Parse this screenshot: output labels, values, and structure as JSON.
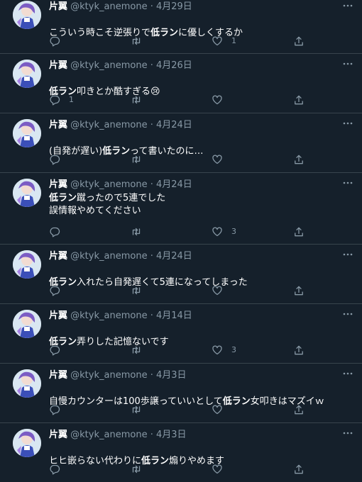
{
  "tweets": [
    {
      "display_name": "片翼",
      "handle": "@ktyk_anemone",
      "separator": "·",
      "date": "4月29日",
      "text_parts": [
        {
          "t": "こういう時こそ逆張りで",
          "b": false
        },
        {
          "t": "低ラン",
          "b": true
        },
        {
          "t": "に優しくするか",
          "b": false
        }
      ],
      "replies": "",
      "retweets": "",
      "likes": "1"
    },
    {
      "display_name": "片翼",
      "handle": "@ktyk_anemone",
      "separator": "·",
      "date": "4月26日",
      "text_parts": [
        {
          "t": "低ラン",
          "b": true
        },
        {
          "t": "叩きとか酷すぎる😢",
          "b": false
        }
      ],
      "replies": "1",
      "retweets": "",
      "likes": ""
    },
    {
      "display_name": "片翼",
      "handle": "@ktyk_anemone",
      "separator": "·",
      "date": "4月24日",
      "text_parts": [
        {
          "t": "(自発が遅い)",
          "b": false
        },
        {
          "t": "低ラン",
          "b": true
        },
        {
          "t": "って書いたのに…",
          "b": false
        }
      ],
      "replies": "",
      "retweets": "",
      "likes": ""
    },
    {
      "display_name": "片翼",
      "handle": "@ktyk_anemone",
      "separator": "·",
      "date": "4月24日",
      "text_parts": [
        {
          "t": "低ラン",
          "b": true
        },
        {
          "t": "蹴ったので5連でした\n誤情報やめてください",
          "b": false
        }
      ],
      "replies": "",
      "retweets": "",
      "likes": "3"
    },
    {
      "display_name": "片翼",
      "handle": "@ktyk_anemone",
      "separator": "·",
      "date": "4月24日",
      "text_parts": [
        {
          "t": "低ラン",
          "b": true
        },
        {
          "t": "入れたら自発遅くて5連になってしまった",
          "b": false
        }
      ],
      "replies": "",
      "retweets": "",
      "likes": ""
    },
    {
      "display_name": "片翼",
      "handle": "@ktyk_anemone",
      "separator": "·",
      "date": "4月14日",
      "text_parts": [
        {
          "t": "低ラン",
          "b": true
        },
        {
          "t": "弄りした記憶ないです",
          "b": false
        }
      ],
      "replies": "",
      "retweets": "",
      "likes": "3"
    },
    {
      "display_name": "片翼",
      "handle": "@ktyk_anemone",
      "separator": "·",
      "date": "4月3日",
      "text_parts": [
        {
          "t": "自慢カウンターは100歩譲っていいとして",
          "b": false
        },
        {
          "t": "低ラン",
          "b": true
        },
        {
          "t": "女叩きはマズイｗ",
          "b": false
        }
      ],
      "replies": "",
      "retweets": "",
      "likes": ""
    },
    {
      "display_name": "片翼",
      "handle": "@ktyk_anemone",
      "separator": "·",
      "date": "4月3日",
      "text_parts": [
        {
          "t": "ヒヒ嵌らない代わりに",
          "b": false
        },
        {
          "t": "低ラン",
          "b": true
        },
        {
          "t": "煽りやめます",
          "b": false
        }
      ],
      "replies": "",
      "retweets": "",
      "likes": ""
    }
  ],
  "icons": {
    "more": "more-horizontal-icon",
    "reply": "reply-bubble-icon",
    "retweet": "retweet-icon",
    "like": "heart-icon",
    "share": "share-upload-icon"
  },
  "colors": {
    "background": "#15202b",
    "divider": "#38444d",
    "secondary_text": "#8899a6",
    "icon": "#8899a6"
  }
}
